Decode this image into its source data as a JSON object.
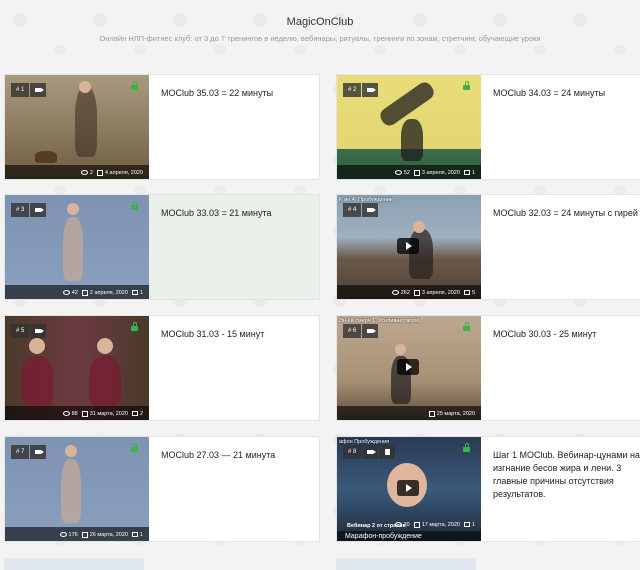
{
  "header": {
    "title": "MagicOnClub",
    "subtitle": "Онлайн НЛП-фитнес клуб: от 3 до 7 тренингов в неделю, вебинары, ритуалы, тренинги по зонам, стретчинг, обучающие уроки"
  },
  "cards": [
    {
      "num": "# 1",
      "title": "MOClub 35.03 = 22 минуты",
      "views": "2",
      "date": "4 апреля, 2020",
      "comments": "",
      "locked": true
    },
    {
      "num": "# 2",
      "title": "MOClub 34.03 = 24 минуты",
      "views": "52",
      "date": "3 апреля, 2020",
      "comments": "1",
      "locked": true
    },
    {
      "num": "# 3",
      "title": "MOClub 33.03 = 21 минута",
      "views": "42",
      "date": "2 апреля, 2020",
      "comments": "1",
      "locked": true
    },
    {
      "num": "# 4",
      "title": "MOClub 32.03 = 24 минуты с гирей",
      "views": "262",
      "date": "3 апреля, 2020",
      "comments": "5",
      "locked": false,
      "overlay": "K   ин 4. Пробуждение"
    },
    {
      "num": "# 5",
      "title": "MOClub 31.03 - 15 минут",
      "views": "88",
      "date": "31 марта, 2020",
      "comments": "2",
      "locked": true
    },
    {
      "num": "# 6",
      "title": "MOClub 30.03 - 25 минут",
      "views": "",
      "date": "25 марта, 2020",
      "comments": "",
      "locked": true,
      "overlay": "Эн   ей смерч 1. Усиливает волю,"
    },
    {
      "num": "# 7",
      "title": "MOClub 27.03 — 21 минута",
      "views": "176",
      "date": "26 марта, 2020",
      "comments": "1",
      "locked": true
    },
    {
      "num": "# 8",
      "title": "Шаг 1 MOClub. Вебинар-цунами на изгнание бесов жира и лени. 3 главные причины отсутствия результатов.",
      "views": "20",
      "date": "17 марта, 2020",
      "comments": "1",
      "locked": true,
      "overlay": "    афон Пробуждения",
      "caption_top": "Вебинар 2 от страхов",
      "caption_bottom": "Марафон-пробуждение"
    }
  ],
  "icons": {
    "video": "video-camera-icon",
    "doc": "document-icon",
    "lock": "unlocked-icon",
    "views": "eye-icon",
    "date": "calendar-icon",
    "comments": "comment-icon",
    "play": "play-icon"
  },
  "colors": {
    "lock": "#3bb54a",
    "highlight_card": "#e9f1ea"
  }
}
